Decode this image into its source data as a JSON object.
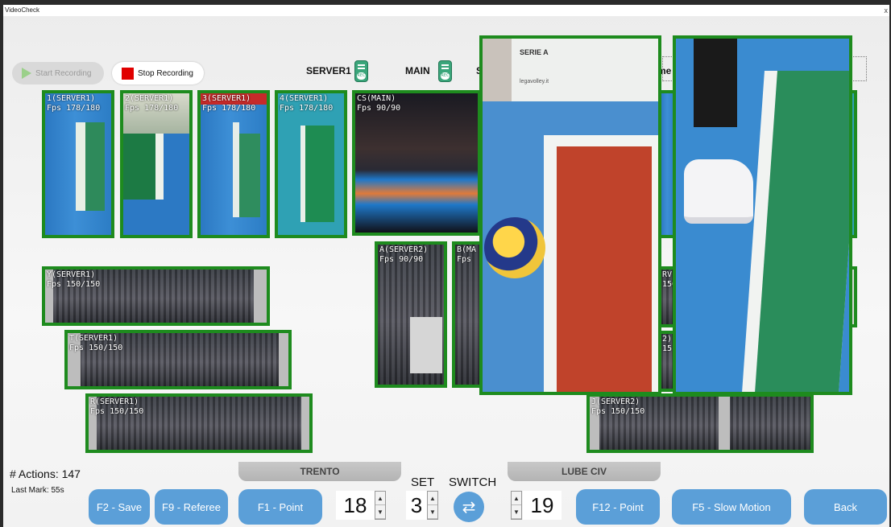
{
  "window": {
    "title": "VideoCheck",
    "close": "x"
  },
  "toolbar": {
    "start_recording": "Start Recording",
    "stop_recording": "Stop Recording",
    "server1": "SERVER1",
    "main": "MAIN",
    "frag_s": "S",
    "frag_me": "me"
  },
  "cameras": [
    {
      "name": "1(SERVER1)",
      "fps": "Fps 178/180"
    },
    {
      "name": "2(SERVER1)",
      "fps": "Fps 178/180"
    },
    {
      "name": "3(SERVER1)",
      "fps": "Fps 178/180"
    },
    {
      "name": "4(SERVER1)",
      "fps": "Fps 178/180"
    },
    {
      "name": "CS(MAIN)",
      "fps": "Fps 90/90"
    },
    {
      "name": "A(SERVER2)",
      "fps": "Fps 90/90"
    },
    {
      "name": "B(MA",
      "fps": "Fps"
    },
    {
      "name": "Y(SERVER1)",
      "fps": "Fps 150/150"
    },
    {
      "name": "T(SERVER1)",
      "fps": "Fps 150/150"
    },
    {
      "name": "R(SERVER1)",
      "fps": "Fps 150/150"
    },
    {
      "name": "J(SERVER2)",
      "fps": "Fps 150/150"
    },
    {
      "name": "RVI",
      "fps": "150"
    },
    {
      "name": "2)",
      "fps": "15"
    }
  ],
  "status": {
    "actions": "# Actions: 147",
    "last_mark": "Last Mark: 55s"
  },
  "controls": {
    "save": "F2 - Save",
    "referee": "F9 - Referee",
    "point_left": "F1 - Point",
    "point_right": "F12 - Point",
    "slow_motion": "F5 - Slow Motion",
    "back": "Back",
    "set_label": "SET",
    "switch_label": "SWITCH",
    "spin_up": "▲",
    "spin_down": "▼",
    "switch_icon": "⇄"
  },
  "teams": {
    "left": "TRENTO",
    "right": "LUBE CIV"
  },
  "score": {
    "left": "18",
    "set": "3",
    "right": "19"
  },
  "banner": {
    "line1": "SERIE A",
    "line2": "legavolley.it"
  },
  "colors": {
    "tile_border": "#1e8b1e",
    "button_blue": "#5b9fd8",
    "stop_red": "#e00000"
  }
}
